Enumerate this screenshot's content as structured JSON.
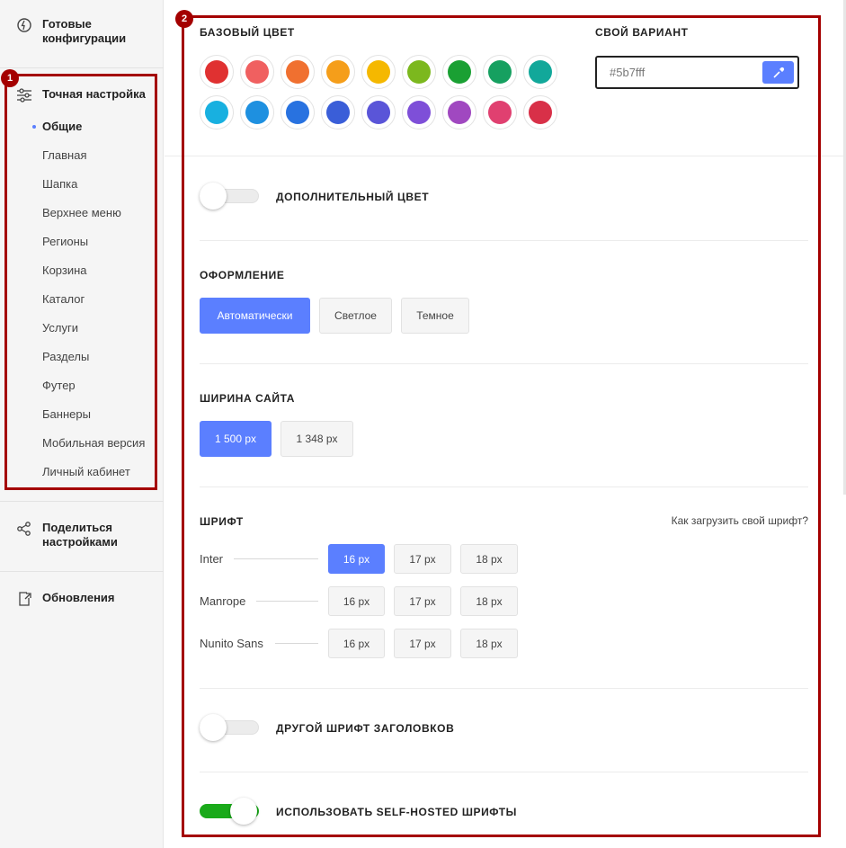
{
  "sidebar": {
    "ready_configs": "Готовые конфигурации",
    "fine_tuning": "Точная настройка",
    "sub_items": [
      {
        "label": "Общие",
        "active": true
      },
      {
        "label": "Главная",
        "active": false
      },
      {
        "label": "Шапка",
        "active": false
      },
      {
        "label": "Верхнее меню",
        "active": false
      },
      {
        "label": "Регионы",
        "active": false
      },
      {
        "label": "Корзина",
        "active": false
      },
      {
        "label": "Каталог",
        "active": false
      },
      {
        "label": "Услуги",
        "active": false
      },
      {
        "label": "Разделы",
        "active": false
      },
      {
        "label": "Футер",
        "active": false
      },
      {
        "label": "Баннеры",
        "active": false
      },
      {
        "label": "Мобильная версия",
        "active": false
      },
      {
        "label": "Личный кабинет",
        "active": false
      }
    ],
    "share_settings": "Поделиться настройками",
    "updates": "Обновления"
  },
  "annotations": {
    "box1": "1",
    "box2": "2"
  },
  "base_color": {
    "title": "Базовый цвет",
    "swatches": [
      "#e03131",
      "#f06060",
      "#f07030",
      "#f59e1a",
      "#f5b800",
      "#7cb81e",
      "#1aa033",
      "#16a060",
      "#12a89a",
      "#18b0e0",
      "#1e90e0",
      "#2872e0",
      "#3a5ed8",
      "#5a55d8",
      "#7e4fd8",
      "#a048c0",
      "#e04070",
      "#d83048"
    ]
  },
  "custom_color": {
    "title": "Свой вариант",
    "value": "#5b7fff",
    "icon": "eyedropper-icon"
  },
  "extra_color": {
    "label": "Дополнительный цвет",
    "enabled": false
  },
  "appearance": {
    "title": "Оформление",
    "options": [
      {
        "label": "Автоматически",
        "active": true
      },
      {
        "label": "Светлое",
        "active": false
      },
      {
        "label": "Темное",
        "active": false
      }
    ]
  },
  "site_width": {
    "title": "Ширина сайта",
    "options": [
      {
        "label": "1 500 px",
        "active": true
      },
      {
        "label": "1 348 px",
        "active": false
      }
    ]
  },
  "font": {
    "title": "Шрифт",
    "link": "Как загрузить свой шрифт?",
    "fonts": [
      {
        "name": "Inter",
        "sizes": [
          {
            "label": "16 px",
            "active": true
          },
          {
            "label": "17 px",
            "active": false
          },
          {
            "label": "18 px",
            "active": false
          }
        ]
      },
      {
        "name": "Manrope",
        "sizes": [
          {
            "label": "16 px",
            "active": false
          },
          {
            "label": "17 px",
            "active": false
          },
          {
            "label": "18 px",
            "active": false
          }
        ]
      },
      {
        "name": "Nunito Sans",
        "sizes": [
          {
            "label": "16 px",
            "active": false
          },
          {
            "label": "17 px",
            "active": false
          },
          {
            "label": "18 px",
            "active": false
          }
        ]
      }
    ]
  },
  "heading_font": {
    "label": "Другой шрифт заголовков",
    "enabled": false
  },
  "self_hosted": {
    "label": "Использовать self-hosted шрифты",
    "enabled": true
  },
  "colors": {
    "accent": "#5b7fff",
    "toggle_on": "#1aaa1a",
    "annotation": "#a40000"
  }
}
